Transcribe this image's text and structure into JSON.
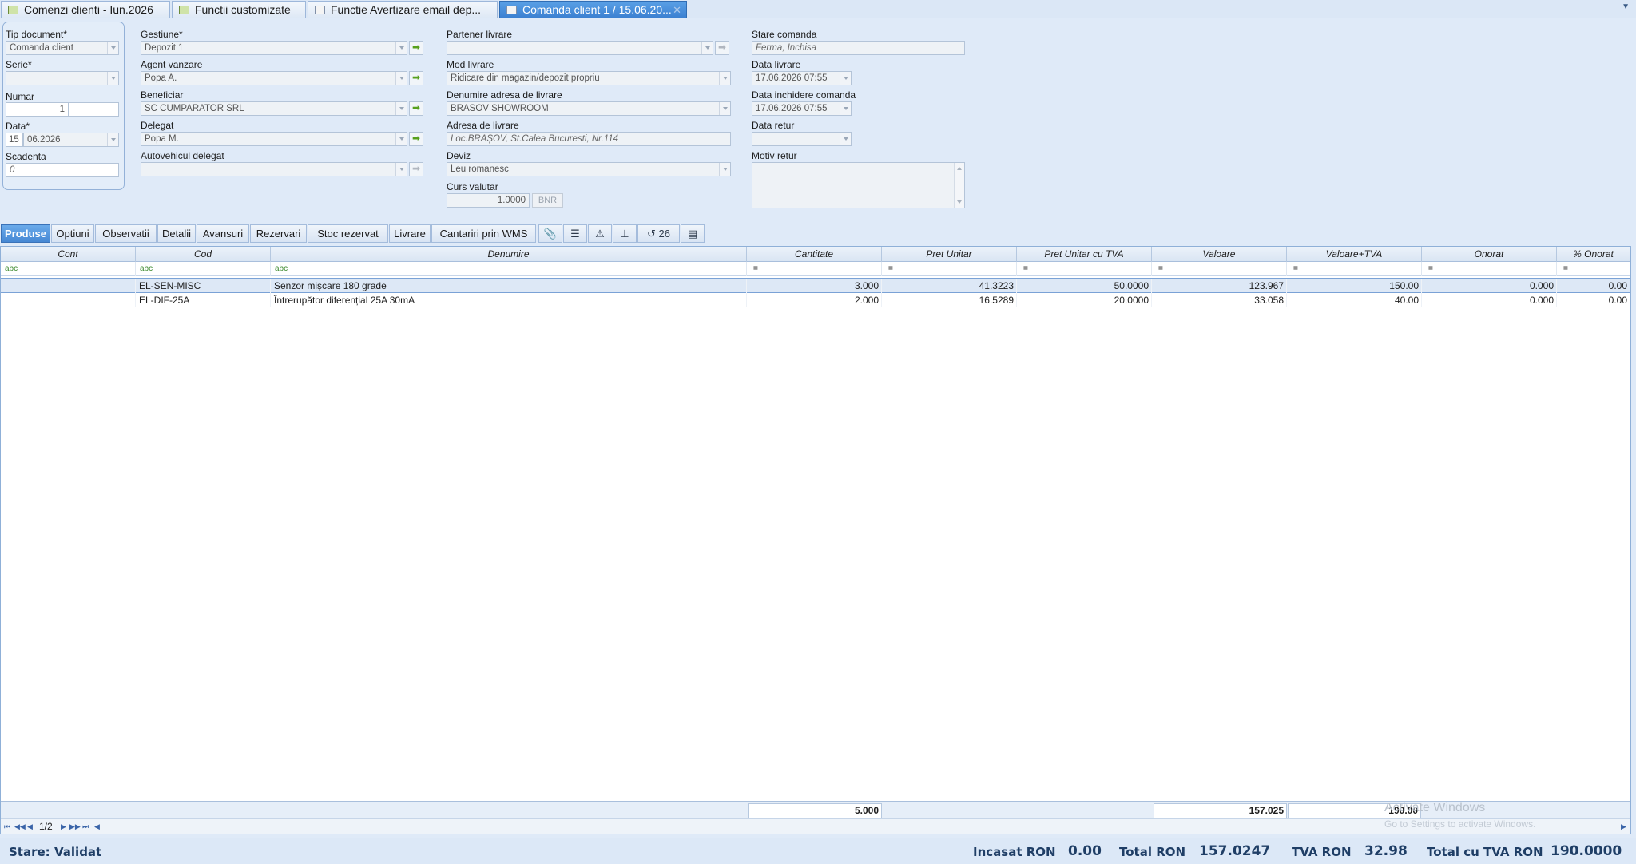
{
  "tabs": [
    {
      "label": "Comenzi clienti - Iun.2026",
      "icon": "table-icon"
    },
    {
      "label": "Functii customizate",
      "icon": "table-icon"
    },
    {
      "label": "Functie Avertizare email dep...",
      "icon": "document-icon"
    },
    {
      "label": "Comanda client 1 / 15.06.20...",
      "icon": "document-icon",
      "active": true
    }
  ],
  "form": {
    "tip_document": {
      "label": "Tip document*",
      "value": "Comanda client"
    },
    "serie": {
      "label": "Serie*",
      "value": ""
    },
    "numar": {
      "label": "Numar",
      "value": "1",
      "suffix": ""
    },
    "data": {
      "label": "Data*",
      "day": "15",
      "value": "06.2026"
    },
    "scadenta": {
      "label": "Scadenta",
      "value": "0"
    },
    "gestiune": {
      "label": "Gestiune*",
      "value": "Depozit 1"
    },
    "agent": {
      "label": "Agent vanzare",
      "value": "Popa A."
    },
    "beneficiar": {
      "label": "Beneficiar",
      "value": "SC CUMPARATOR SRL"
    },
    "delegat": {
      "label": "Delegat",
      "value": "Popa M."
    },
    "autovehicul": {
      "label": "Autovehicul delegat",
      "value": ""
    },
    "partener_livrare": {
      "label": "Partener livrare",
      "value": ""
    },
    "mod_livrare": {
      "label": "Mod livrare",
      "value": "Ridicare din magazin/depozit propriu"
    },
    "denumire_adresa": {
      "label": "Denumire adresa de livrare",
      "value": "BRASOV SHOWROOM"
    },
    "adresa_livrare": {
      "label": "Adresa de livrare",
      "value": "Loc.BRAȘOV, St.Calea Bucuresti, Nr.114"
    },
    "deviz": {
      "label": "Deviz",
      "value": "Leu romanesc"
    },
    "curs_valutar": {
      "label": "Curs valutar",
      "value": "1.0000",
      "source": "BNR"
    },
    "stare_comanda": {
      "label": "Stare comanda",
      "value": "Ferma, Inchisa"
    },
    "data_livrare": {
      "label": "Data livrare",
      "value": "17.06.2026 07:55"
    },
    "data_inchidere": {
      "label": "Data inchidere comanda",
      "value": "17.06.2026 07:55"
    },
    "data_retur": {
      "label": "Data retur",
      "value": ""
    },
    "motiv_retur": {
      "label": "Motiv retur",
      "value": ""
    }
  },
  "section_tabs": [
    "Produse",
    "Optiuni",
    "Observatii",
    "Detalii",
    "Avansuri",
    "Rezervari",
    "Stoc rezervat",
    "Livrare",
    "Cantariri prin WMS"
  ],
  "section_icon_tabs": [
    "paperclip-icon",
    "checklist-icon",
    "warning-icon",
    "stamp-icon",
    "history-icon",
    "note-icon"
  ],
  "history_count": "26",
  "grid": {
    "columns": [
      "Cont",
      "Cod",
      "Denumire",
      "Cantitate",
      "Pret Unitar",
      "Pret Unitar cu TVA",
      "Valoare",
      "Valoare+TVA",
      "Onorat",
      "% Onorat"
    ],
    "filter_text": "abc",
    "filter_eq": "=",
    "rows": [
      {
        "cont": "",
        "cod": "EL-SEN-MISC",
        "denumire": "Senzor mișcare 180 grade",
        "cantitate": "3.000",
        "pret_unitar": "41.3223",
        "pret_tva": "50.0000",
        "valoare": "123.967",
        "valoare_tva": "150.00",
        "onorat": "0.000",
        "pct_onorat": "0.00"
      },
      {
        "cont": "",
        "cod": "EL-DIF-25A",
        "denumire": "Întrerupător diferențial 25A 30mA",
        "cantitate": "2.000",
        "pret_unitar": "16.5289",
        "pret_tva": "20.0000",
        "valoare": "33.058",
        "valoare_tva": "40.00",
        "onorat": "0.000",
        "pct_onorat": "0.00"
      }
    ],
    "totals": {
      "cantitate": "5.000",
      "valoare": "157.025",
      "valoare_tva": "190.00"
    },
    "pager": "1/2"
  },
  "watermark": {
    "title": "Activate Windows",
    "subtitle": "Go to Settings to activate Windows."
  },
  "status": {
    "stare_label": "Stare:",
    "stare_value": "Validat",
    "incasat_label": "Incasat RON",
    "incasat_value": "0.00",
    "total_label": "Total RON",
    "total_value": "157.0247",
    "tva_label": "TVA RON",
    "tva_value": "32.98",
    "total_tva_label": "Total cu TVA RON",
    "total_tva_value": "190.0000"
  }
}
